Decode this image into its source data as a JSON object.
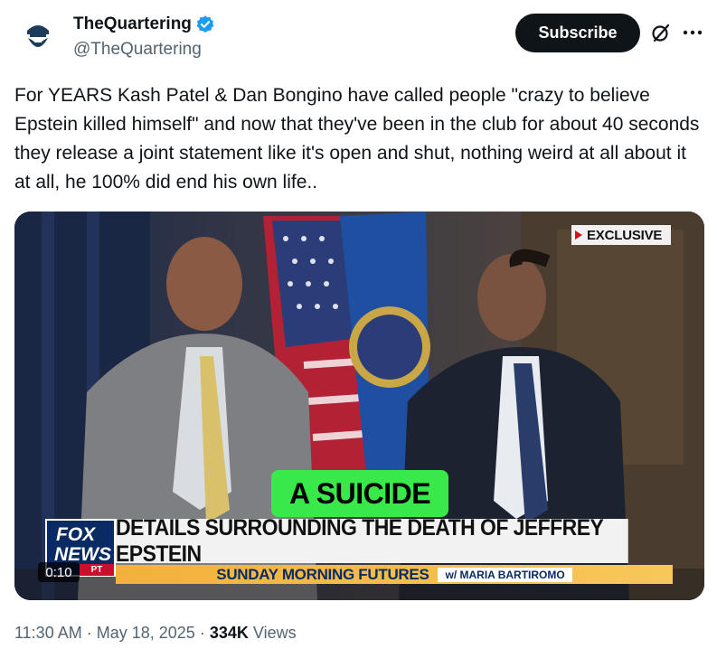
{
  "author": {
    "display_name": "TheQuartering",
    "handle": "@TheQuartering"
  },
  "header": {
    "subscribe_label": "Subscribe",
    "grok_icon": "grok-slash-circle-icon",
    "more_icon": "more-horizontal-icon"
  },
  "tweet": {
    "text": "For YEARS Kash Patel & Dan Bongino have called people \"crazy to believe Epstein killed himself\" and now that they've been in the club for about 40 seconds they release a joint statement like it's open and shut, nothing weird at all about it at all, he 100% did end his own life.."
  },
  "video": {
    "exclusive_label": "EXCLUSIVE",
    "caption": "A SUICIDE",
    "logo_top": "FOX",
    "logo_bottom": "NEWS",
    "logo_badge": "PT",
    "headline": "DETAILS SURROUNDING THE DEATH OF JEFFREY EPSTEIN",
    "show_name": "SUNDAY MORNING FUTURES",
    "host": "w/ MARIA BARTIROMO",
    "duration": "0:10"
  },
  "footer": {
    "time": "11:30 AM",
    "separator": "·",
    "date": "May 18, 2025",
    "views_count": "334K",
    "views_label": "Views"
  },
  "colors": {
    "accent_black": "#0f1419",
    "secondary_text": "#536471",
    "verified_blue": "#1d9bf0",
    "caption_green": "#39e94a",
    "fox_navy": "#0a2a63",
    "fox_red": "#c8102e"
  }
}
